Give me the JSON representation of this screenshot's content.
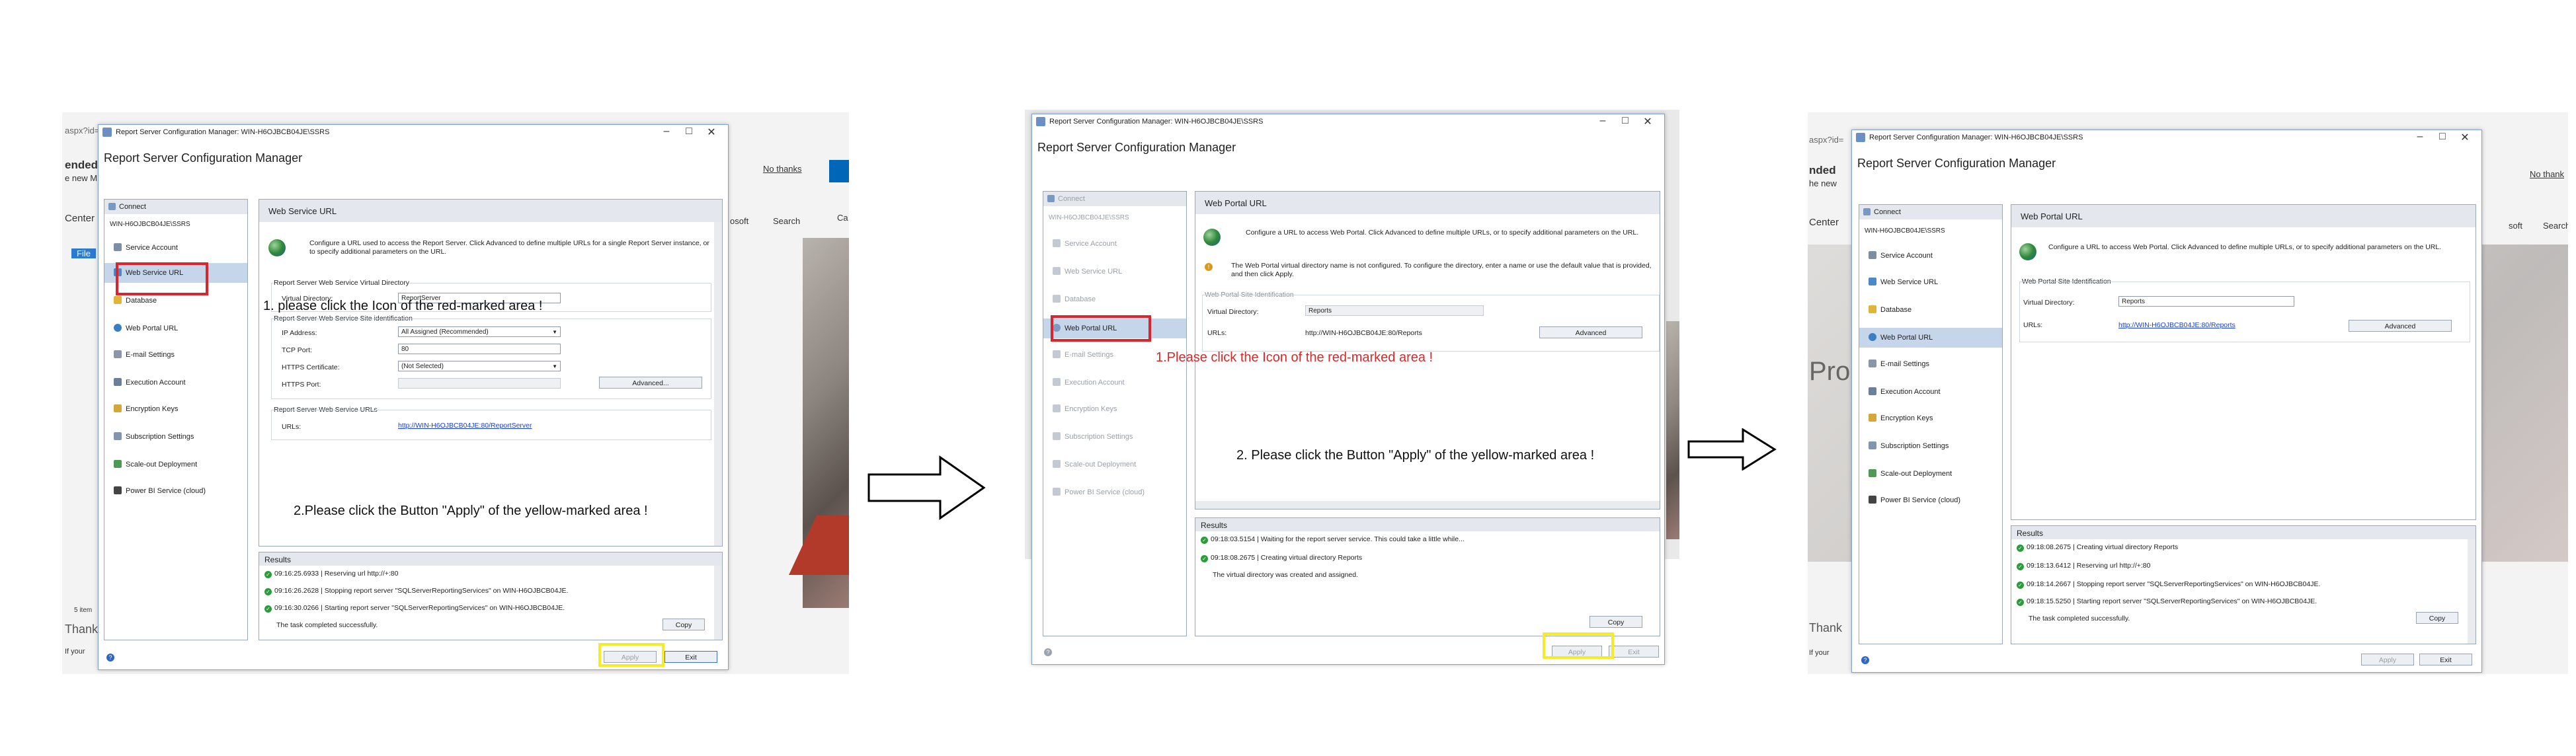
{
  "panel1": {
    "bg": {
      "url_fragment": "aspx?id=",
      "heading_fragment": "ended",
      "sub_fragment": "e new M",
      "no_thanks": "No thanks",
      "center": "Center",
      "file": "File",
      "soft": "osoft",
      "search": "Search",
      "ca": "Ca",
      "thank": "Thank",
      "ifyour": "If your",
      "items": "5 item"
    },
    "window_title": "Report Server Configuration Manager: WIN-H6OJBCB04JE\\SSRS",
    "app_title": "Report Server Configuration Manager",
    "connect": "Connect",
    "server": "WIN-H6OJBCB04JE\\SSRS",
    "nav": [
      "Service Account",
      "Web Service URL",
      "Database",
      "Web Portal URL",
      "E-mail Settings",
      "Execution Account",
      "Encryption Keys",
      "Subscription Settings",
      "Scale-out Deployment",
      "Power BI Service (cloud)"
    ],
    "selected_nav": "Web Service URL",
    "page_title": "Web Service URL",
    "description": "Configure a URL used to access the Report Server. Click Advanced to define multiple URLs for a single Report Server instance, or to specify additional parameters on the URL.",
    "vdir_group": "Report Server Web Service Virtual Directory",
    "vdir_label": "Virtual Directory:",
    "vdir_value": "ReportServer",
    "site_group": "Report Server Web Service Site identification",
    "ip_label": "IP Address:",
    "ip_value": "All Assigned (Recommended)",
    "tcp_label": "TCP Port:",
    "tcp_value": "80",
    "https_cert_label": "HTTPS Certificate:",
    "https_cert_value": "(Not Selected)",
    "https_port_label": "HTTPS Port:",
    "advanced": "Advanced...",
    "urls_group": "Report Server Web Service URLs",
    "urls_label": "URLs:",
    "url": "http://WIN-H6OJBCB04JE:80/ReportServer",
    "annotation1": "1. please click the Icon of the red-marked area !",
    "annotation2": "2.Please click the Button \"Apply\" of the yellow-marked area !",
    "results_title": "Results",
    "results": [
      "09:16:25.6933 | Reserving url http://+:80",
      "09:16:26.2628 | Stopping report server \"SQLServerReportingServices\" on WIN-H6OJBCB04JE.",
      "09:16:30.0266 | Starting report server \"SQLServerReportingServices\" on WIN-H6OJBCB04JE."
    ],
    "results_final": "The task completed successfully.",
    "copy": "Copy",
    "apply": "Apply",
    "exit": "Exit"
  },
  "panel2": {
    "window_title": "Report Server Configuration Manager: WIN-H6OJBCB04JE\\SSRS",
    "app_title": "Report Server Configuration Manager",
    "connect": "Connect",
    "server": "WIN-H6OJBCB04JE\\SSRS",
    "nav": [
      "Service Account",
      "Web Service URL",
      "Database",
      "Web Portal URL",
      "E-mail Settings",
      "Execution Account",
      "Encryption Keys",
      "Subscription Settings",
      "Scale-out Deployment",
      "Power BI Service (cloud)"
    ],
    "selected_nav": "Web Portal URL",
    "page_title": "Web Portal URL",
    "description": "Configure a URL to access Web Portal. Click Advanced to define multiple URLs, or to specify additional parameters on the URL.",
    "warning": "The Web Portal virtual directory name is not configured. To configure the directory, enter a name or use the default value that is provided, and then click Apply.",
    "site_group": "Web Portal Site Identification",
    "vdir_label": "Virtual Directory:",
    "vdir_value": "Reports",
    "urls_label": "URLs:",
    "url": "http://WIN-H6OJBCB04JE:80/Reports",
    "advanced": "Advanced",
    "annotation1": "1.Please click the Icon of the red-marked area !",
    "annotation2": "2. Please click the Button \"Apply\" of the yellow-marked area !",
    "results_title": "Results",
    "results": [
      "09:18:03.5154 | Waiting for the report server service. This could take a little while...",
      "09:18:08.2675 | Creating virtual directory Reports"
    ],
    "results_final": "The virtual directory was created and assigned.",
    "copy": "Copy",
    "apply": "Apply",
    "exit": "Exit"
  },
  "panel3": {
    "bg": {
      "url_fragment": "aspx?id=",
      "heading_fragment": "nded",
      "sub_fragment": "he new",
      "no_thanks": "No thank",
      "center": "Center",
      "pro": "Pro",
      "soft": "soft",
      "search": "Search",
      "thank": "Thank",
      "ifyour": "If your"
    },
    "window_title": "Report Server Configuration Manager: WIN-H6OJBCB04JE\\SSRS",
    "app_title": "Report Server Configuration Manager",
    "connect": "Connect",
    "server": "WIN-H6OJBCB04JE\\SSRS",
    "nav": [
      "Service Account",
      "Web Service URL",
      "Database",
      "Web Portal URL",
      "E-mail Settings",
      "Execution Account",
      "Encryption Keys",
      "Subscription Settings",
      "Scale-out Deployment",
      "Power BI Service (cloud)"
    ],
    "selected_nav": "Web Portal URL",
    "page_title": "Web Portal URL",
    "description": "Configure a URL to access Web Portal. Click Advanced to define multiple URLs, or to specify additional parameters on the URL.",
    "site_group": "Web Portal Site Identification",
    "vdir_label": "Virtual Directory:",
    "vdir_value": "Reports",
    "urls_label": "URLs:",
    "url": "http://WIN-H6OJBCB04JE:80/Reports",
    "advanced": "Advanced",
    "results_title": "Results",
    "results": [
      "09:18:08.2675 | Creating virtual directory Reports",
      "09:18:13.6412 | Reserving url http://+:80",
      "09:18:14.2667 | Stopping report server \"SQLServerReportingServices\" on WIN-H6OJBCB04JE.",
      "09:18:15.5250 | Starting report server \"SQLServerReportingServices\" on WIN-H6OJBCB04JE."
    ],
    "results_final": "The task completed successfully.",
    "copy": "Copy",
    "apply": "Apply",
    "exit": "Exit"
  },
  "colors": {
    "accent": "#0067b8",
    "annotation_red": "#d9262e",
    "annotation_yellow": "#f4ec2b",
    "selected_nav": "#c5d5ea",
    "header_bg": "#e4e8ee"
  }
}
